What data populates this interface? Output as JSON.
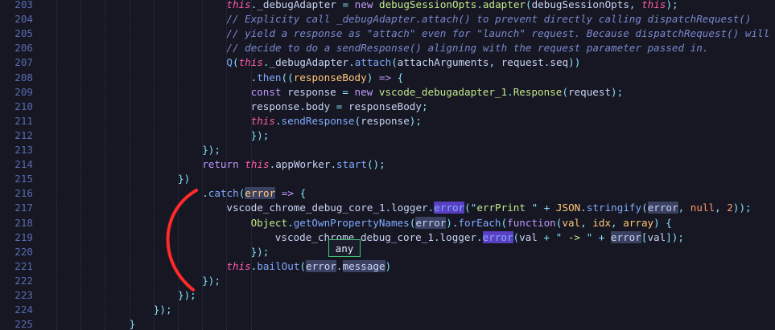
{
  "editor": {
    "accent_color": "#ff2a2a",
    "tooltip_border_color": "#3fc47a",
    "hover_tooltip": "any",
    "lines": [
      {
        "n": "203",
        "tokens": [
          [
            "this",
            "tk-this"
          ],
          [
            ".",
            "tk-punc"
          ],
          [
            "_debugAdapter ",
            "tk-prop"
          ],
          [
            "= ",
            "tk-punc"
          ],
          [
            "new ",
            "tk-kw"
          ],
          [
            "debugSessionOpts",
            "tk-cls"
          ],
          [
            ".",
            "tk-punc"
          ],
          [
            "adapter",
            "tk-cls"
          ],
          [
            "(",
            "tk-punc"
          ],
          [
            "debugSessionOpts",
            "tk-prop"
          ],
          [
            ", ",
            "tk-punc"
          ],
          [
            "this",
            "tk-this"
          ],
          [
            ");",
            "tk-punc"
          ]
        ]
      },
      {
        "n": "204",
        "tokens": [
          [
            "// Explicity call _debugAdapter.attach() to prevent directly calling dispatchRequest()",
            "tk-cmt"
          ]
        ]
      },
      {
        "n": "205",
        "tokens": [
          [
            "// yield a response as \"attach\" even for \"launch\" request. Because dispatchRequest() will",
            "tk-cmt"
          ]
        ]
      },
      {
        "n": "206",
        "tokens": [
          [
            "// decide to do a sendResponse() aligning with the request parameter passed in.",
            "tk-cmt"
          ]
        ]
      },
      {
        "n": "207",
        "tokens": [
          [
            "Q",
            "tk-fn"
          ],
          [
            "(",
            "tk-punc"
          ],
          [
            "this",
            "tk-this"
          ],
          [
            ".",
            "tk-punc"
          ],
          [
            "_debugAdapter",
            "tk-prop"
          ],
          [
            ".",
            "tk-punc"
          ],
          [
            "attach",
            "tk-fn"
          ],
          [
            "(",
            "tk-punc"
          ],
          [
            "attachArguments",
            "tk-prop"
          ],
          [
            ", ",
            "tk-punc"
          ],
          [
            "request",
            "tk-prop"
          ],
          [
            ".",
            "tk-punc"
          ],
          [
            "seq",
            "tk-prop"
          ],
          [
            "))",
            "tk-punc"
          ]
        ]
      },
      {
        "n": "208",
        "tokens": [
          [
            ".",
            "tk-punc"
          ],
          [
            "then",
            "tk-fn"
          ],
          [
            "((",
            "tk-punc"
          ],
          [
            "responseBody",
            "tk-param"
          ],
          [
            ") ",
            "tk-punc"
          ],
          [
            "=> ",
            "tk-kw"
          ],
          [
            "{",
            "tk-punc"
          ]
        ]
      },
      {
        "n": "209",
        "tokens": [
          [
            "const ",
            "tk-kw"
          ],
          [
            "response ",
            "tk-prop"
          ],
          [
            "= ",
            "tk-punc"
          ],
          [
            "new ",
            "tk-kw"
          ],
          [
            "vscode_debugadapter_1",
            "tk-cls"
          ],
          [
            ".",
            "tk-punc"
          ],
          [
            "Response",
            "tk-cls"
          ],
          [
            "(",
            "tk-punc"
          ],
          [
            "request",
            "tk-prop"
          ],
          [
            ");",
            "tk-punc"
          ]
        ]
      },
      {
        "n": "210",
        "tokens": [
          [
            "response",
            "tk-prop"
          ],
          [
            ".",
            "tk-punc"
          ],
          [
            "body ",
            "tk-prop"
          ],
          [
            "= ",
            "tk-punc"
          ],
          [
            "responseBody",
            "tk-prop"
          ],
          [
            ";",
            "tk-punc"
          ]
        ]
      },
      {
        "n": "211",
        "tokens": [
          [
            "this",
            "tk-this"
          ],
          [
            ".",
            "tk-punc"
          ],
          [
            "sendResponse",
            "tk-fn"
          ],
          [
            "(",
            "tk-punc"
          ],
          [
            "response",
            "tk-prop"
          ],
          [
            ");",
            "tk-punc"
          ]
        ]
      },
      {
        "n": "212",
        "tokens": [
          [
            "});",
            "tk-punc"
          ]
        ]
      },
      {
        "n": "213",
        "tokens": [
          [
            "});",
            "tk-punc"
          ]
        ]
      },
      {
        "n": "214",
        "tokens": [
          [
            "return ",
            "tk-kw"
          ],
          [
            "this",
            "tk-this"
          ],
          [
            ".",
            "tk-punc"
          ],
          [
            "appWorker",
            "tk-prop"
          ],
          [
            ".",
            "tk-punc"
          ],
          [
            "start",
            "tk-fn"
          ],
          [
            "();",
            "tk-punc"
          ]
        ]
      },
      {
        "n": "215",
        "tokens": [
          [
            "})",
            "tk-punc"
          ]
        ]
      },
      {
        "n": "216",
        "tokens": [
          [
            ".",
            "tk-punc"
          ],
          [
            "catch",
            "tk-fn"
          ],
          [
            "(",
            "tk-punc"
          ],
          [
            "error",
            "tk-param hl"
          ],
          [
            " => ",
            "tk-kw"
          ],
          [
            "{",
            "tk-punc"
          ]
        ]
      },
      {
        "n": "217",
        "tokens": [
          [
            "vscode_chrome_debug_core_1",
            "tk-prop"
          ],
          [
            ".",
            "tk-punc"
          ],
          [
            "logger",
            "tk-prop"
          ],
          [
            ".",
            "tk-punc"
          ],
          [
            "error",
            "tk-fn hl-strong"
          ],
          [
            "(\"",
            "tk-punc"
          ],
          [
            "errPrint ",
            "tk-str"
          ],
          [
            "\" + ",
            "tk-punc"
          ],
          [
            "JSON",
            "tk-param"
          ],
          [
            ".",
            "tk-punc"
          ],
          [
            "stringify",
            "tk-fn"
          ],
          [
            "(",
            "tk-punc"
          ],
          [
            "error",
            "tk-prop hl"
          ],
          [
            ", ",
            "tk-punc"
          ],
          [
            "null",
            "tk-null"
          ],
          [
            ", ",
            "tk-punc"
          ],
          [
            "2",
            "tk-num"
          ],
          [
            "));",
            "tk-punc"
          ]
        ]
      },
      {
        "n": "218",
        "tokens": [
          [
            "Object",
            "tk-cls"
          ],
          [
            ".",
            "tk-punc"
          ],
          [
            "getOwnPropertyNames",
            "tk-fn"
          ],
          [
            "(",
            "tk-punc"
          ],
          [
            "error",
            "tk-prop hl"
          ],
          [
            ").",
            "tk-punc"
          ],
          [
            "forEach",
            "tk-fn"
          ],
          [
            "(",
            "tk-punc"
          ],
          [
            "function",
            "tk-kw"
          ],
          [
            "(",
            "tk-punc"
          ],
          [
            "val",
            "tk-param"
          ],
          [
            ", ",
            "tk-punc"
          ],
          [
            "idx",
            "tk-param"
          ],
          [
            ", ",
            "tk-punc"
          ],
          [
            "array",
            "tk-param"
          ],
          [
            ") {",
            "tk-punc"
          ]
        ]
      },
      {
        "n": "219",
        "tokens": [
          [
            "vscode_chrome_debug_core_1",
            "tk-prop"
          ],
          [
            ".",
            "tk-punc"
          ],
          [
            "logger",
            "tk-prop"
          ],
          [
            ".",
            "tk-punc"
          ],
          [
            "error",
            "tk-fn hl-strong"
          ],
          [
            "(",
            "tk-punc"
          ],
          [
            "val ",
            "tk-prop"
          ],
          [
            "+ \"",
            "tk-punc"
          ],
          [
            " -> ",
            "tk-str"
          ],
          [
            "\" + ",
            "tk-punc"
          ],
          [
            "error",
            "tk-prop hl"
          ],
          [
            "[",
            "tk-punc"
          ],
          [
            "val",
            "tk-prop"
          ],
          [
            "]);",
            "tk-punc"
          ]
        ]
      },
      {
        "n": "220",
        "tokens": [
          [
            "});",
            "tk-punc"
          ]
        ]
      },
      {
        "n": "221",
        "tokens": [
          [
            "this",
            "tk-this"
          ],
          [
            ".",
            "tk-punc"
          ],
          [
            "bailOut",
            "tk-fn"
          ],
          [
            "(",
            "tk-punc"
          ],
          [
            "error",
            "tk-prop hl"
          ],
          [
            ".",
            "tk-punc"
          ],
          [
            "message",
            "tk-prop hl"
          ],
          [
            ")",
            "tk-punc"
          ]
        ]
      },
      {
        "n": "222",
        "tokens": [
          [
            "});",
            "tk-punc"
          ]
        ]
      },
      {
        "n": "223",
        "tokens": [
          [
            "});",
            "tk-punc"
          ]
        ]
      },
      {
        "n": "224",
        "tokens": [
          [
            "});",
            "tk-punc"
          ]
        ]
      },
      {
        "n": "225",
        "tokens": [
          [
            "}",
            "tk-punc"
          ]
        ]
      }
    ]
  }
}
